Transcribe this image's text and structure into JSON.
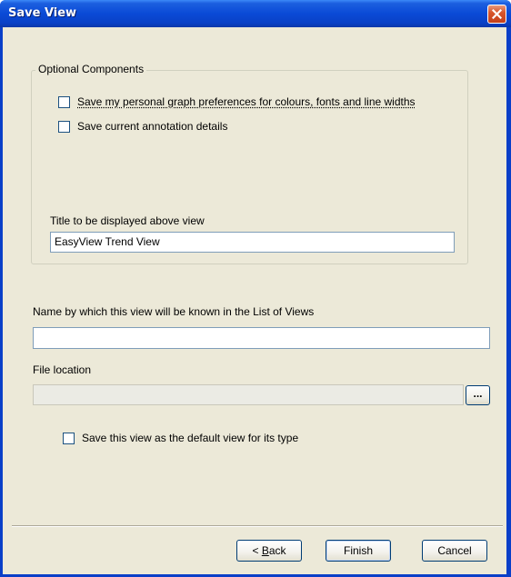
{
  "window": {
    "title": "Save View"
  },
  "optional_components": {
    "legend": "Optional Components",
    "checkbox_graph_prefs": {
      "label": "Save my personal graph preferences for colours, fonts and line widths",
      "checked": false
    },
    "checkbox_annotation": {
      "label": "Save current annotation details",
      "checked": false
    },
    "title_label": "Title to be displayed above view",
    "title_value": "EasyView Trend View"
  },
  "name_field": {
    "label": "Name by which this view will be known in the List of Views",
    "value": ""
  },
  "file_location": {
    "label": "File location",
    "value": "",
    "browse_label": "..."
  },
  "default_view": {
    "label": "Save this view as the default view for its type",
    "checked": false
  },
  "buttons": {
    "back_underline": "B",
    "back_rest": "ack",
    "back_prefix": "< ",
    "finish": "Finish",
    "cancel": "Cancel"
  }
}
